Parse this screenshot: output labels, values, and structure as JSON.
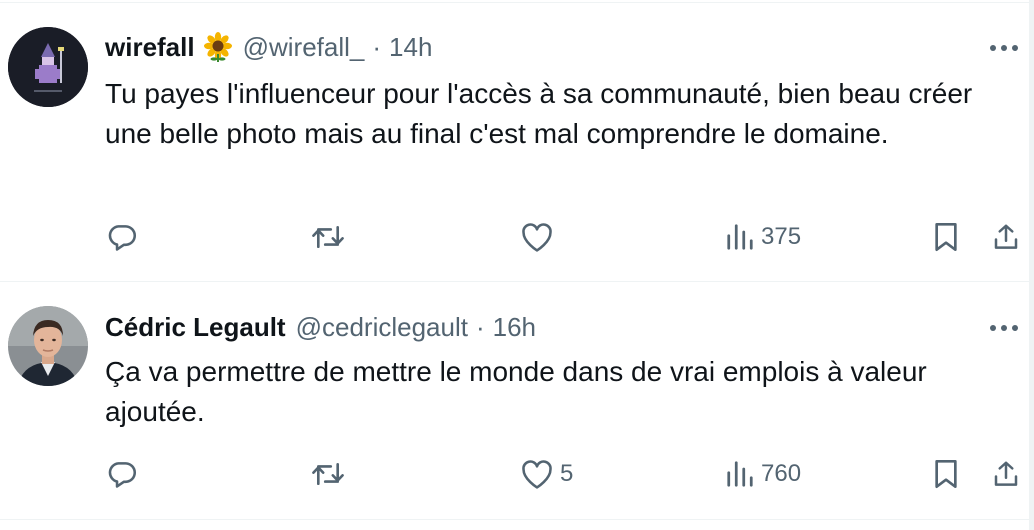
{
  "tweets": [
    {
      "name": "wirefall",
      "handle": "@wirefall_",
      "separator": "·",
      "time": "14h",
      "text": "Tu payes l'influenceur pour l'accès à sa communauté, bien beau créer une belle photo mais au final c'est mal comprendre le domaine.",
      "likes": "",
      "views": "375"
    },
    {
      "name": "Cédric Legault",
      "handle": "@cedriclegault",
      "separator": "·",
      "time": "16h",
      "text": "Ça va permettre de mettre le monde dans de vrai emplois à valeur ajoutée.",
      "likes": "5",
      "views": "760"
    }
  ],
  "icons": {
    "more": "more-dots-icon",
    "reply": "reply-icon",
    "retweet": "retweet-icon",
    "like": "like-icon",
    "views": "views-icon",
    "bookmark": "bookmark-icon",
    "share": "share-icon",
    "badge": "sunflower-icon"
  },
  "colors": {
    "text": "#0f1419",
    "secondary": "#536471",
    "divider": "#eff3f4"
  }
}
